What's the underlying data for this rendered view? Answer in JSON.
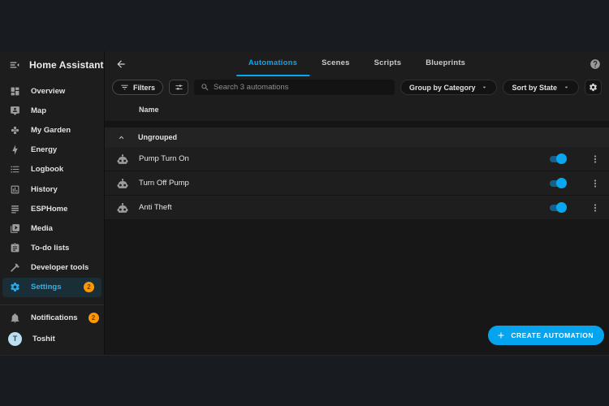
{
  "sidebar": {
    "title": "Home Assistant",
    "items": [
      {
        "label": "Overview",
        "icon": "dashboard-icon"
      },
      {
        "label": "Map",
        "icon": "map-icon"
      },
      {
        "label": "My Garden",
        "icon": "garden-icon"
      },
      {
        "label": "Energy",
        "icon": "energy-icon"
      },
      {
        "label": "Logbook",
        "icon": "logbook-icon"
      },
      {
        "label": "History",
        "icon": "history-icon"
      },
      {
        "label": "ESPHome",
        "icon": "esphome-icon"
      },
      {
        "label": "Media",
        "icon": "media-icon"
      },
      {
        "label": "To-do lists",
        "icon": "todo-icon"
      },
      {
        "label": "Developer tools",
        "icon": "hammer-icon"
      },
      {
        "label": "Settings",
        "icon": "gear-icon",
        "badge": "2",
        "active": true
      }
    ],
    "notifications": {
      "label": "Notifications",
      "badge": "2"
    },
    "profile": {
      "name": "Toshit",
      "initial": "T"
    }
  },
  "header": {
    "tabs": [
      {
        "label": "Automations",
        "active": true
      },
      {
        "label": "Scenes"
      },
      {
        "label": "Scripts"
      },
      {
        "label": "Blueprints"
      }
    ]
  },
  "toolbar": {
    "filters_label": "Filters",
    "search_placeholder": "Search 3 automations",
    "group_by": "Group by Category",
    "sort_by": "Sort by State"
  },
  "table": {
    "name_header": "Name",
    "group_label": "Ungrouped",
    "rows": [
      {
        "name": "Pump Turn On",
        "enabled": true
      },
      {
        "name": "Turn Off Pump",
        "enabled": true
      },
      {
        "name": "Anti Theft",
        "enabled": true
      }
    ]
  },
  "fab": {
    "label": "CREATE AUTOMATION"
  },
  "colors": {
    "accent": "#03a9f4",
    "badge": "#ff9800"
  }
}
